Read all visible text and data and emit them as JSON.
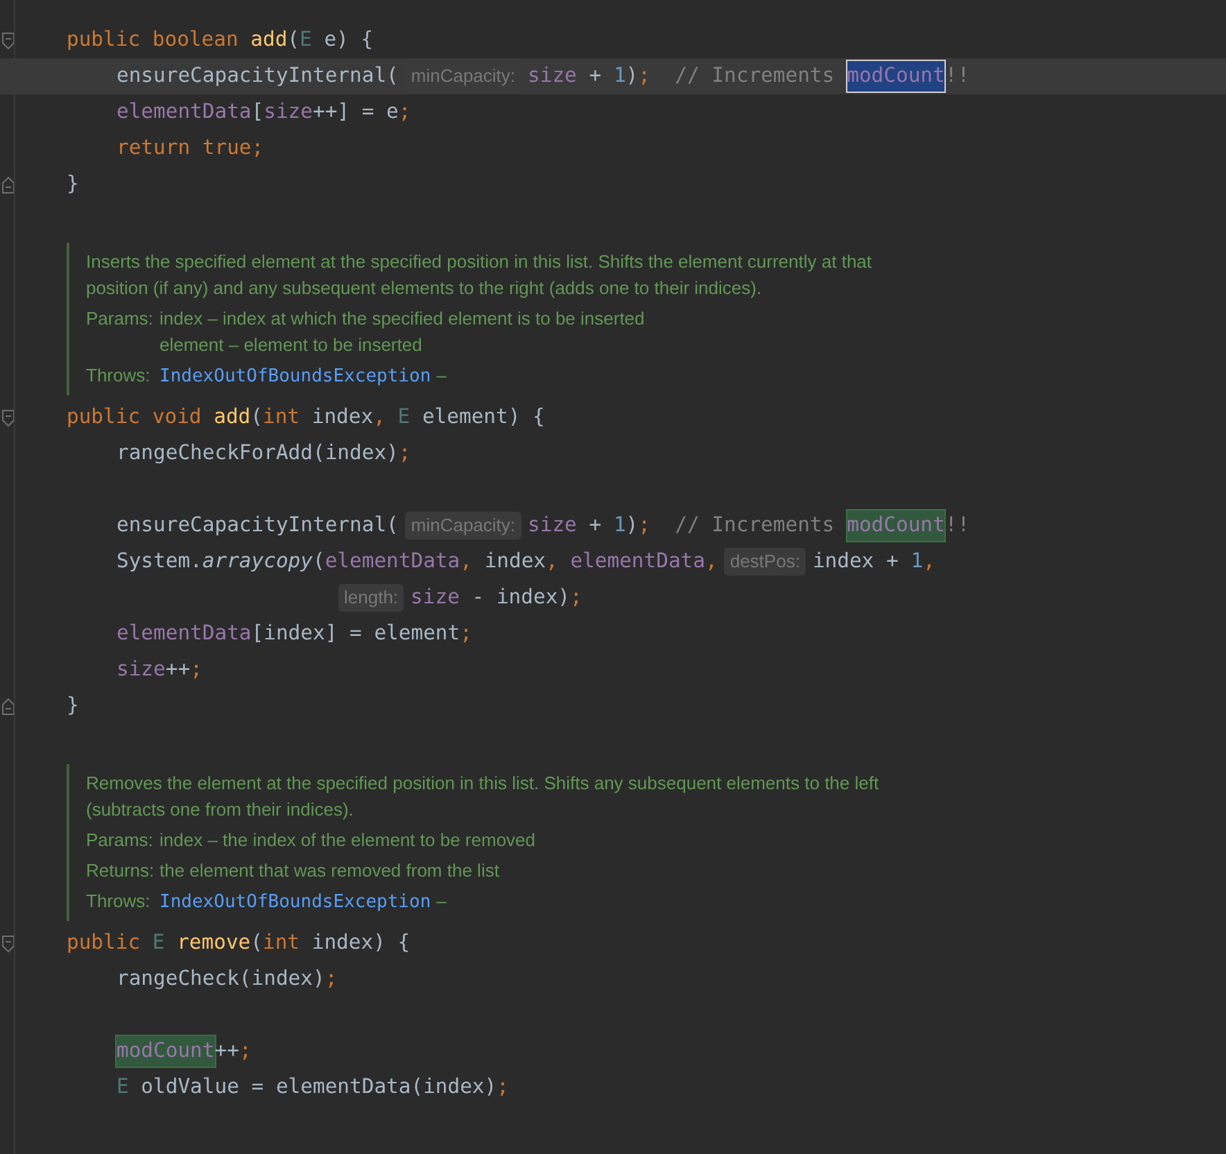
{
  "blocks": [
    {
      "kind": "code",
      "lines": [
        {
          "kind": "block-start",
          "segments": [
            {
              "kind": "code",
              "tokens": [
                {
                  "text": "public boolean ",
                  "color": "#cc7832"
                },
                {
                  "text": "add",
                  "color": "#ffc66d"
                },
                {
                  "text": "(",
                  "color": "#a9b7c6"
                },
                {
                  "text": "E",
                  "color": "#507874"
                },
                {
                  "text": " e) {",
                  "color": "#a9b7c6"
                }
              ]
            }
          ],
          "children": [
            {
              "kind": "code",
              "current": true,
              "segments": [
                {
                  "kind": "code",
                  "tokens": [
                    {
                      "text": "ensureCapacityInternal(",
                      "color": "#a9b7c6"
                    }
                  ]
                },
                {
                  "kind": "hint",
                  "text": "minCapacity:"
                },
                {
                  "kind": "code",
                  "tokens": [
                    {
                      "text": "size",
                      "color": "#9876aa"
                    },
                    {
                      "text": " + ",
                      "color": "#a9b7c6"
                    },
                    {
                      "text": "1",
                      "color": "#6897bb"
                    },
                    {
                      "text": ")",
                      "color": "#a9b7c6"
                    },
                    {
                      "text": ";",
                      "color": "#cc7832"
                    },
                    {
                      "text": "  // Increments",
                      "color": "#808080"
                    }
                  ]
                },
                {
                  "kind": "selection",
                  "text": "modCount"
                },
                {
                  "kind": "code",
                  "tokens": [
                    {
                      "text": "!!",
                      "color": "#808080"
                    }
                  ]
                }
              ]
            },
            {
              "kind": "code",
              "segments": [
                {
                  "kind": "code",
                  "tokens": [
                    {
                      "text": "elementData",
                      "color": "#9876aa"
                    },
                    {
                      "text": "[",
                      "color": "#a9b7c6"
                    },
                    {
                      "text": "size",
                      "color": "#9876aa"
                    },
                    {
                      "text": "++] = e",
                      "color": "#a9b7c6"
                    },
                    {
                      "text": ";",
                      "color": "#cc7832"
                    }
                  ]
                }
              ]
            },
            {
              "kind": "code",
              "segments": [
                {
                  "kind": "code",
                  "tokens": [
                    {
                      "text": "return true;",
                      "color": "#cc7832"
                    }
                  ]
                }
              ]
            }
          ]
        },
        {
          "kind": "block-end",
          "segments": [
            {
              "kind": "code",
              "tokens": [
                {
                  "text": "}",
                  "color": "#a9b7c6"
                }
              ]
            }
          ]
        }
      ]
    },
    {
      "kind": "doc",
      "description": "Inserts the specified element at the specified position in this list. Shifts the element currently at that position (if any) and any subsequent elements to the right (adds one to their indices).",
      "tags": [
        {
          "label": "Params:",
          "items": [
            [
              {
                "kind": "text",
                "text": "index – index at which the specified element is to be inserted"
              }
            ],
            [
              {
                "kind": "text",
                "text": "element – element to be inserted"
              }
            ]
          ]
        },
        {
          "label": "Throws:",
          "items": [
            [
              {
                "kind": "link",
                "text": "IndexOutOfBoundsException"
              },
              {
                "kind": "text",
                "text": "–"
              }
            ]
          ]
        }
      ]
    },
    {
      "kind": "code",
      "lines": [
        {
          "kind": "block-start",
          "segments": [
            {
              "kind": "code",
              "tokens": [
                {
                  "text": "public void ",
                  "color": "#cc7832"
                },
                {
                  "text": "add",
                  "color": "#ffc66d"
                },
                {
                  "text": "(",
                  "color": "#a9b7c6"
                },
                {
                  "text": "int ",
                  "color": "#cc7832"
                },
                {
                  "text": "index",
                  "color": "#a9b7c6"
                },
                {
                  "text": ", ",
                  "color": "#cc7832"
                },
                {
                  "text": "E",
                  "color": "#507874"
                },
                {
                  "text": " element) {",
                  "color": "#a9b7c6"
                }
              ]
            }
          ],
          "children": [
            {
              "kind": "code",
              "segments": [
                {
                  "kind": "code",
                  "tokens": [
                    {
                      "text": "rangeCheckForAdd(index)",
                      "color": "#a9b7c6"
                    },
                    {
                      "text": ";",
                      "color": "#cc7832"
                    }
                  ]
                }
              ]
            },
            {
              "kind": "blank"
            },
            {
              "kind": "code",
              "segments": [
                {
                  "kind": "code",
                  "tokens": [
                    {
                      "text": "ensureCapacityInternal(",
                      "color": "#a9b7c6"
                    }
                  ]
                },
                {
                  "kind": "hint",
                  "text": "minCapacity:"
                },
                {
                  "kind": "code",
                  "tokens": [
                    {
                      "text": "size",
                      "color": "#9876aa"
                    },
                    {
                      "text": " + ",
                      "color": "#a9b7c6"
                    },
                    {
                      "text": "1",
                      "color": "#6897bb"
                    },
                    {
                      "text": ")",
                      "color": "#a9b7c6"
                    },
                    {
                      "text": ";",
                      "color": "#cc7832"
                    },
                    {
                      "text": "  // Increments",
                      "color": "#808080"
                    }
                  ]
                },
                {
                  "kind": "match",
                  "text": "modCount"
                },
                {
                  "kind": "code",
                  "tokens": [
                    {
                      "text": "!!",
                      "color": "#808080"
                    }
                  ]
                }
              ]
            },
            {
              "kind": "code",
              "segments": [
                {
                  "kind": "code",
                  "tokens": [
                    {
                      "text": "System.",
                      "color": "#a9b7c6"
                    },
                    {
                      "text": "arraycopy",
                      "color": "#a9b7c6",
                      "italic": true
                    },
                    {
                      "text": "(",
                      "color": "#a9b7c6"
                    },
                    {
                      "text": "elementData",
                      "color": "#9876aa"
                    },
                    {
                      "text": ", ",
                      "color": "#cc7832"
                    },
                    {
                      "text": "index",
                      "color": "#a9b7c6"
                    },
                    {
                      "text": ", ",
                      "color": "#cc7832"
                    },
                    {
                      "text": "elementData",
                      "color": "#9876aa"
                    },
                    {
                      "text": ",",
                      "color": "#cc7832"
                    }
                  ]
                },
                {
                  "kind": "hint",
                  "text": "destPos:"
                },
                {
                  "kind": "code",
                  "tokens": [
                    {
                      "text": "index + ",
                      "color": "#a9b7c6"
                    },
                    {
                      "text": "1",
                      "color": "#6897bb"
                    },
                    {
                      "text": ",",
                      "color": "#cc7832"
                    }
                  ]
                }
              ]
            },
            {
              "kind": "continuation",
              "segments": [
                {
                  "kind": "hint",
                  "text": "length:"
                },
                {
                  "kind": "code",
                  "tokens": [
                    {
                      "text": "size",
                      "color": "#9876aa"
                    },
                    {
                      "text": " - index)",
                      "color": "#a9b7c6"
                    },
                    {
                      "text": ";",
                      "color": "#cc7832"
                    }
                  ]
                }
              ]
            },
            {
              "kind": "code",
              "segments": [
                {
                  "kind": "code",
                  "tokens": [
                    {
                      "text": "elementData",
                      "color": "#9876aa"
                    },
                    {
                      "text": "[index] = element",
                      "color": "#a9b7c6"
                    },
                    {
                      "text": ";",
                      "color": "#cc7832"
                    }
                  ]
                }
              ]
            },
            {
              "kind": "code",
              "segments": [
                {
                  "kind": "code",
                  "tokens": [
                    {
                      "text": "size",
                      "color": "#9876aa"
                    },
                    {
                      "text": "++",
                      "color": "#a9b7c6"
                    },
                    {
                      "text": ";",
                      "color": "#cc7832"
                    }
                  ]
                }
              ]
            }
          ]
        },
        {
          "kind": "block-end",
          "segments": [
            {
              "kind": "code",
              "tokens": [
                {
                  "text": "}",
                  "color": "#a9b7c6"
                }
              ]
            }
          ]
        }
      ]
    },
    {
      "kind": "doc",
      "description": "Removes the element at the specified position in this list. Shifts any subsequent elements to the left (subtracts one from their indices).",
      "tags": [
        {
          "label": "Params:",
          "items": [
            [
              {
                "kind": "text",
                "text": "index – the index of the element to be removed"
              }
            ]
          ]
        },
        {
          "label": "Returns:",
          "items": [
            [
              {
                "kind": "text",
                "text": "the element that was removed from the list"
              }
            ]
          ]
        },
        {
          "label": "Throws:",
          "items": [
            [
              {
                "kind": "link",
                "text": "IndexOutOfBoundsException"
              },
              {
                "kind": "text",
                "text": "–"
              }
            ]
          ]
        }
      ]
    },
    {
      "kind": "code",
      "lines": [
        {
          "kind": "block-start",
          "segments": [
            {
              "kind": "code",
              "tokens": [
                {
                  "text": "public ",
                  "color": "#cc7832"
                },
                {
                  "text": "E ",
                  "color": "#507874"
                },
                {
                  "text": "remove",
                  "color": "#ffc66d"
                },
                {
                  "text": "(",
                  "color": "#a9b7c6"
                },
                {
                  "text": "int ",
                  "color": "#cc7832"
                },
                {
                  "text": "index) {",
                  "color": "#a9b7c6"
                }
              ]
            }
          ],
          "children": [
            {
              "kind": "code",
              "segments": [
                {
                  "kind": "code",
                  "tokens": [
                    {
                      "text": "rangeCheck(index)",
                      "color": "#a9b7c6"
                    },
                    {
                      "text": ";",
                      "color": "#cc7832"
                    }
                  ]
                }
              ]
            },
            {
              "kind": "blank"
            },
            {
              "kind": "code",
              "segments": [
                {
                  "kind": "match",
                  "text": "modCount"
                },
                {
                  "kind": "code",
                  "tokens": [
                    {
                      "text": "++",
                      "color": "#a9b7c6"
                    },
                    {
                      "text": ";",
                      "color": "#cc7832"
                    }
                  ]
                }
              ]
            },
            {
              "kind": "code",
              "segments": [
                {
                  "kind": "code",
                  "tokens": [
                    {
                      "text": "E",
                      "color": "#507874"
                    },
                    {
                      "text": " oldValue = elementData(index)",
                      "color": "#a9b7c6"
                    },
                    {
                      "text": ";",
                      "color": "#cc7832"
                    }
                  ]
                }
              ]
            }
          ]
        }
      ]
    }
  ]
}
